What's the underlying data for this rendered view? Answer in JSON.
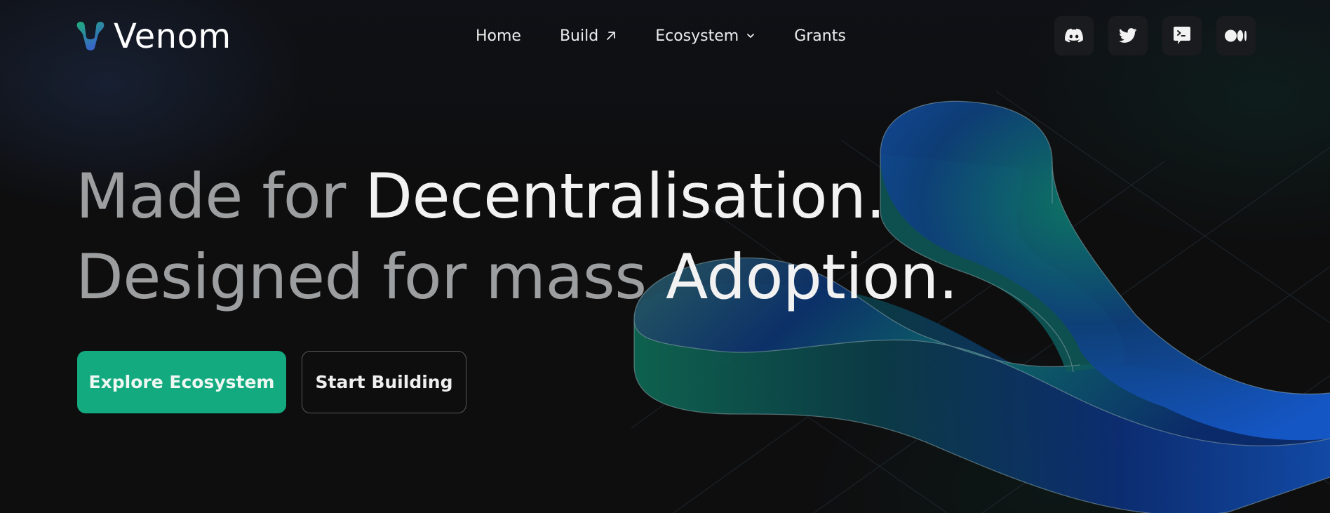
{
  "brand": {
    "name": "Venom",
    "logo_icon": "venom-v-logo-icon"
  },
  "nav": {
    "items": [
      {
        "label": "Home",
        "icon": null
      },
      {
        "label": "Build",
        "icon": "arrow-up-right-icon"
      },
      {
        "label": "Ecosystem",
        "icon": "chevron-down-icon"
      },
      {
        "label": "Grants",
        "icon": null
      }
    ]
  },
  "socials": [
    {
      "name": "Discord",
      "icon": "discord-icon"
    },
    {
      "name": "Twitter",
      "icon": "twitter-icon"
    },
    {
      "name": "Forum",
      "icon": "terminal-chat-icon"
    },
    {
      "name": "Medium",
      "icon": "medium-icon"
    }
  ],
  "hero": {
    "line1_muted": "Made for ",
    "line1_bright": "Decentralisation.",
    "line2_muted": "Designed for mass ",
    "line2_bright": "Adoption."
  },
  "cta": {
    "primary_label": "Explore Ecosystem",
    "secondary_label": "Start Building"
  },
  "colors": {
    "accent": "#13aa80",
    "background": "#0e0e0f",
    "logo_gradient_start": "#1fae7a",
    "logo_gradient_end": "#3a5fd0"
  }
}
